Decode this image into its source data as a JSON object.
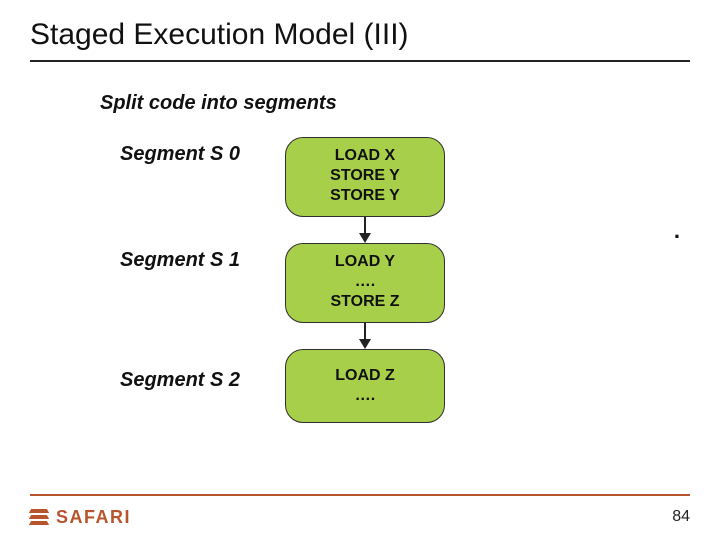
{
  "title": "Staged Execution Model (III)",
  "subtitle": "Split code into segments",
  "segments": [
    {
      "label": "Segment S 0",
      "lines": [
        "LOAD X",
        "STORE Y",
        "STORE Y"
      ]
    },
    {
      "label": "Segment S 1",
      "lines": [
        "LOAD Y",
        "….",
        "STORE Z"
      ]
    },
    {
      "label": "Segment S 2",
      "lines": [
        "LOAD Z",
        "…."
      ]
    }
  ],
  "footer": {
    "logo_text": "SAFARI",
    "page_number": "84",
    "dot": "."
  }
}
